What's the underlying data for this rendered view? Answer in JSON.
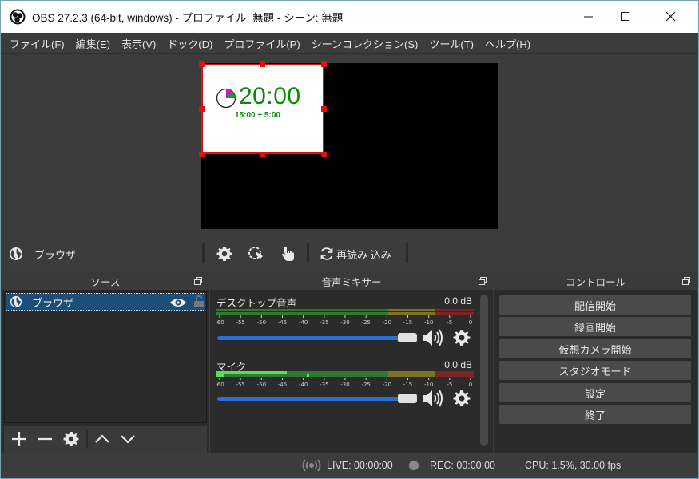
{
  "window": {
    "title": "OBS 27.2.3 (64-bit, windows) - プロファイル: 無題 - シーン: 無題"
  },
  "menu": [
    "ファイル(F)",
    "編集(E)",
    "表示(V)",
    "ドック(D)",
    "プロファイル(P)",
    "シーンコレクション(S)",
    "ツール(T)",
    "ヘルプ(H)"
  ],
  "preview": {
    "timer": "20:00",
    "timer_sub": "15:00 + 5:00"
  },
  "toolbar": {
    "selected_source": "ブラウザ",
    "reload_label": "再読み 込み"
  },
  "sources": {
    "title": "ソース",
    "items": [
      {
        "name": "ブラウザ",
        "visible": true,
        "locked": false
      }
    ]
  },
  "mixer": {
    "title": "音声ミキサー",
    "scale": [
      "-60",
      "-55",
      "-50",
      "-45",
      "-40",
      "-35",
      "-30",
      "-25",
      "-20",
      "-15",
      "-10",
      "-5",
      "0"
    ],
    "channels": [
      {
        "name": "デスクトップ音声",
        "db": "0.0 dB",
        "volume": 1.0
      },
      {
        "name": "マイク",
        "db": "0.0 dB",
        "volume": 1.0
      }
    ]
  },
  "controls": {
    "title": "コントロール",
    "buttons": [
      "配信開始",
      "録画開始",
      "仮想カメラ開始",
      "スタジオモード",
      "設定",
      "終了"
    ]
  },
  "status": {
    "live": "LIVE: 00:00:00",
    "rec": "REC: 00:00:00",
    "cpu": "CPU: 1.5%, 30.00 fps"
  },
  "colors": {
    "accent": "#2a6fd6",
    "selection": "#1d4e7a",
    "handle": "#e01010",
    "meter_green": "#3aa83a",
    "meter_yellow": "#b8a830",
    "meter_red": "#b83030"
  }
}
